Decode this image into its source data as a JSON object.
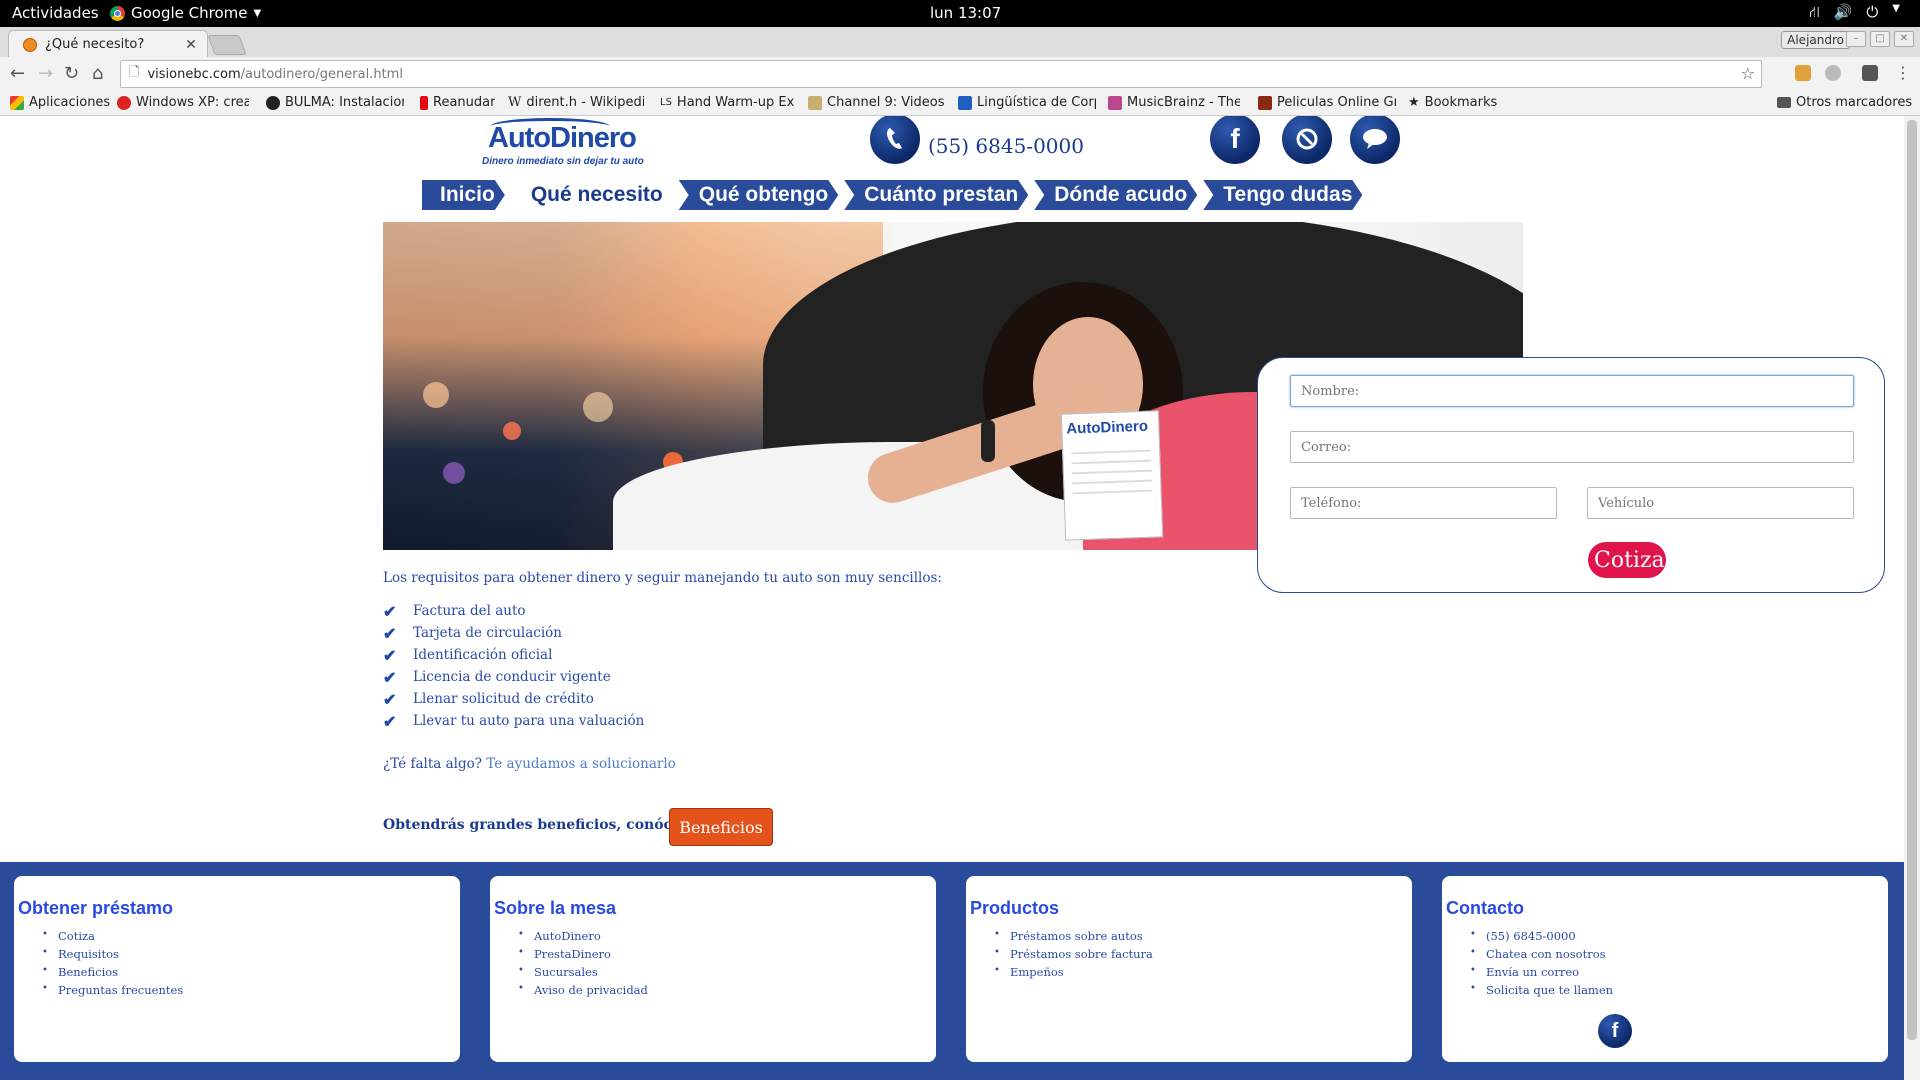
{
  "os": {
    "activities": "Actividades",
    "app_name": "Google Chrome",
    "clock": "lun 13:07"
  },
  "browser": {
    "tab_title": "¿Qué necesito?",
    "user": "Alejandro",
    "url_host": "visionebc.com",
    "url_path": "/autodinero/general.html",
    "bookmarks": [
      "Aplicaciones",
      "Windows XP: crear",
      "BULMA: Instalacion",
      "Reanudar",
      "dirent.h - Wikipedia",
      "Hand Warm-up Exe",
      "Channel 9: Videos",
      "Lingüística de Corp",
      "MusicBrainz - The C",
      "Peliculas Online Gra",
      "Bookmarks",
      "Otros marcadores"
    ]
  },
  "site": {
    "logo_word": "AutoDinero",
    "logo_tagline": "Dinero inmediato sin dejar tu auto",
    "phone": "(55) 6845-0000",
    "nav": [
      "Inicio",
      "Qué necesito",
      "Qué obtengo",
      "Cuánto prestan",
      "Dónde acudo",
      "Tengo dudas"
    ],
    "hero_card_logo": "AutoDinero"
  },
  "form": {
    "nombre_placeholder": "Nombre:",
    "correo_placeholder": "Correo:",
    "telefono_placeholder": "Teléfono:",
    "vehiculo_placeholder": "Vehículo",
    "submit": "Cotiza"
  },
  "content": {
    "intro": "Los requisitos para obtener dinero y seguir manejando tu auto son muy sencillos:",
    "requirements": [
      "Factura del auto",
      "Tarjeta de circulación",
      "Identificación oficial",
      "Licencia de conducir vigente",
      "Llenar solicitud de crédito",
      "Llevar tu auto para una valuación"
    ],
    "missing_q": "¿Té falta algo?",
    "missing_link": "Te ayudamos a solucionarlo",
    "benefits_text": "Obtendrás grandes beneficios, conócelos",
    "benefits_button": "Beneficios"
  },
  "footer": [
    {
      "title": "Obtener préstamo",
      "items": [
        "Cotiza",
        "Requisitos",
        "Beneficios",
        "Preguntas frecuentes"
      ]
    },
    {
      "title": "Sobre la mesa",
      "items": [
        "AutoDinero",
        "PrestaDinero",
        "Sucursales",
        "Aviso de privacidad"
      ]
    },
    {
      "title": "Productos",
      "items": [
        "Préstamos sobre autos",
        "Préstamos sobre factura",
        "Empeños"
      ]
    },
    {
      "title": "Contacto",
      "items": [
        "(55) 6845-0000",
        "Chatea con nosotros",
        "Envía un correo",
        "Solicita que te llamen"
      ]
    }
  ],
  "colors": {
    "brand_blue": "#2a4a9a",
    "cta_red": "#e0144a",
    "cta_orange": "#e5531c"
  }
}
